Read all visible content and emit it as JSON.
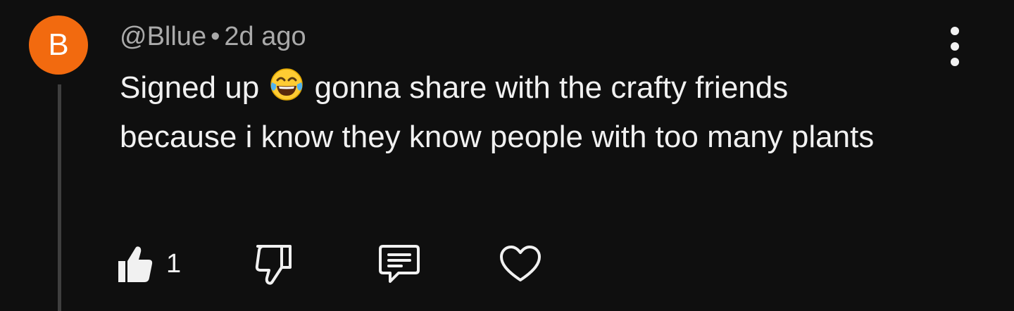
{
  "comment": {
    "avatar_letter": "B",
    "avatar_color": "#f26a0f",
    "author": "@Bllue",
    "separator": "•",
    "time": "2d ago",
    "text_before_emoji": "Signed up",
    "emoji": "face-with-tears-of-joy",
    "text_after_emoji": "gonna share with the crafty friends because i know they know people with too many plants",
    "like_count": "1"
  },
  "icons": {
    "like": "thumbs-up-icon",
    "dislike": "thumbs-down-icon",
    "reply": "reply-comment-icon",
    "heart": "heart-icon",
    "menu": "more-vertical-icon"
  },
  "colors": {
    "background": "#0f0f0f",
    "text": "#f1f1f1",
    "meta": "#aaaaaa",
    "thread_line": "#3f3f3f"
  }
}
